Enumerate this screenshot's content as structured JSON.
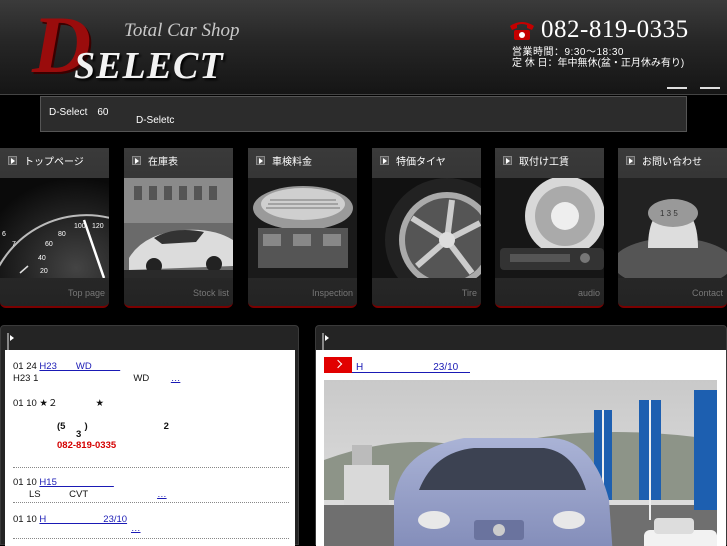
{
  "header": {
    "logo_letter": "D",
    "logo_word": "SELECT",
    "tagline": "Total Car Shop",
    "phone": "082-819-0335",
    "hours": "営業時間：9:30〜18:30",
    "holiday": "定 休 日：年中無休(盆・正月休み有り)"
  },
  "info_bar": {
    "line1": "D-Select　60",
    "line2": "D-Seletc"
  },
  "nav": [
    {
      "label": "トップページ",
      "sub": "Top page",
      "icon": "speedometer-image"
    },
    {
      "label": "在庫表",
      "sub": "Stock list",
      "icon": "sports-car-image"
    },
    {
      "label": "車検料金",
      "sub": "Inspection",
      "icon": "engine-image"
    },
    {
      "label": "特価タイヤ",
      "sub": "Tire",
      "icon": "wheel-image"
    },
    {
      "label": "取付け工賃",
      "sub": "audio",
      "icon": "speaker-image"
    },
    {
      "label": "お問い合わせ",
      "sub": "Contact",
      "icon": "shift-knob-image"
    }
  ],
  "news": {
    "items": [
      {
        "date": "01 24",
        "link": "H23　　WD　　　",
        "line2": "H23 1　　　　　　　　　　WD　　",
        "more": "…"
      },
      {
        "date": "01 10",
        "text": "★２　　　　★",
        "line2": "(5　　)　　　　　　　　2",
        "line3": "3",
        "phone": "082-819-0335"
      },
      {
        "date": "01 10",
        "link": "H15　　　　　　",
        "line2": "LS　　　CVT　　　　　　　",
        "more": "…"
      },
      {
        "date": "01 10",
        "link": "H　　　　　　23/10",
        "more": "…"
      }
    ]
  },
  "featured": {
    "title": "H　　　　　　　23/10"
  },
  "colors": {
    "accent_red": "#e10000",
    "link_blue": "#1a1ab5",
    "logo_red": "#9a0c0c"
  }
}
